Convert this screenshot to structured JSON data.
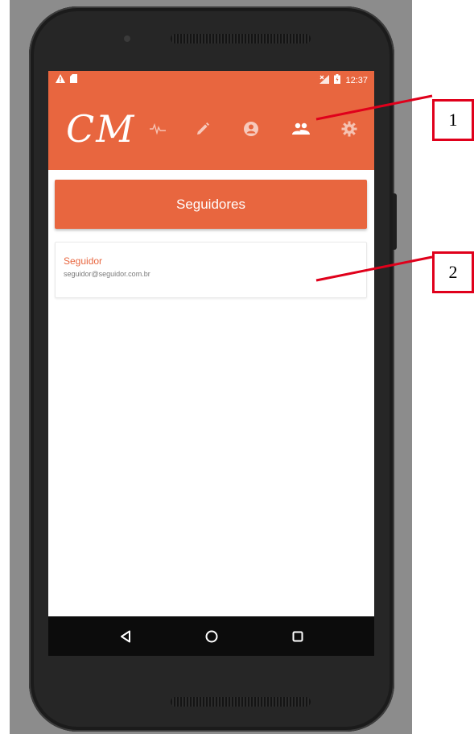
{
  "status_bar": {
    "time": "12:37",
    "left_icons": [
      "warning-icon",
      "sd-card-icon"
    ],
    "right_icons": [
      "no-signal-icon",
      "battery-icon"
    ]
  },
  "header": {
    "logo_text": "CM",
    "nav_icons": [
      "activity-icon",
      "edit-icon",
      "account-icon",
      "people-icon",
      "settings-icon"
    ],
    "active_icon": "people-icon"
  },
  "main": {
    "title": "Seguidores",
    "followers": [
      {
        "name": "Seguidor",
        "email": "seguidor@seguidor.com.br"
      }
    ]
  },
  "system_nav": [
    "back-icon",
    "home-icon",
    "recents-icon"
  ],
  "callouts": {
    "first": "1",
    "second": "2"
  },
  "colors": {
    "accent": "#e8663f",
    "callout": "#e0001b",
    "nav_bar": "#0c0c0c",
    "phone_body": "#262626"
  }
}
